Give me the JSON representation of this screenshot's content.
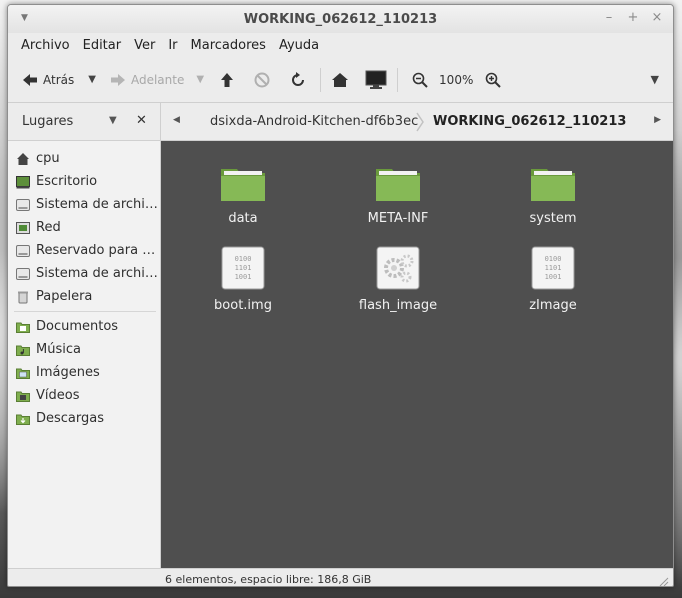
{
  "window": {
    "title": "WORKING_062612_110213"
  },
  "menubar": {
    "items": [
      "Archivo",
      "Editar",
      "Ver",
      "Ir",
      "Marcadores",
      "Ayuda"
    ]
  },
  "toolbar": {
    "back_label": "Atrás",
    "forward_label": "Adelante",
    "zoom_label": "100%"
  },
  "sidebar": {
    "header": "Lugares",
    "places": [
      {
        "label": "cpu",
        "icon": "home-icon"
      },
      {
        "label": "Escritorio",
        "icon": "desktop-icon"
      },
      {
        "label": "Sistema de archiv...",
        "icon": "drive-icon"
      },
      {
        "label": "Red",
        "icon": "network-icon"
      },
      {
        "label": "Reservado para el...",
        "icon": "drive-icon"
      },
      {
        "label": "Sistema de archiv...",
        "icon": "drive-icon"
      },
      {
        "label": "Papelera",
        "icon": "trash-icon"
      }
    ],
    "bookmarks": [
      {
        "label": "Documentos",
        "icon": "folder-documents-icon"
      },
      {
        "label": "Música",
        "icon": "folder-music-icon"
      },
      {
        "label": "Imágenes",
        "icon": "folder-pictures-icon"
      },
      {
        "label": "Vídeos",
        "icon": "folder-videos-icon"
      },
      {
        "label": "Descargas",
        "icon": "folder-downloads-icon"
      }
    ]
  },
  "breadcrumb": {
    "parent": "dsixda-Android-Kitchen-df6b3ec",
    "current": "WORKING_062612_110213"
  },
  "files": [
    {
      "name": "data",
      "type": "folder"
    },
    {
      "name": "META-INF",
      "type": "folder"
    },
    {
      "name": "system",
      "type": "folder"
    },
    {
      "name": "boot.img",
      "type": "binary"
    },
    {
      "name": "flash_image",
      "type": "executable"
    },
    {
      "name": "zImage",
      "type": "binary"
    }
  ],
  "status": {
    "text": "6 elementos, espacio libre: 186,8 GiB"
  },
  "colors": {
    "folder_green": "#7fae4e",
    "content_bg": "#4f4f4f"
  }
}
